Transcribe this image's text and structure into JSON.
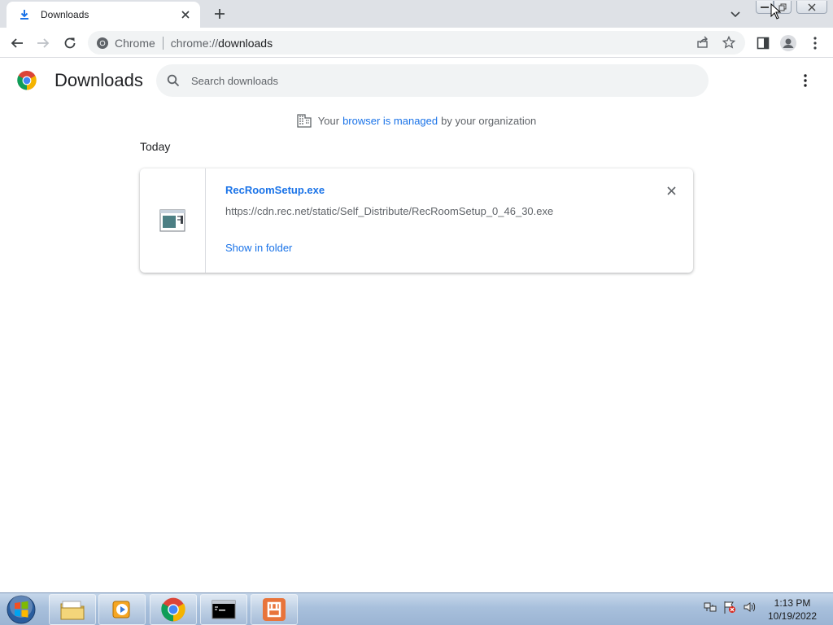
{
  "browser": {
    "tab": {
      "title": "Downloads",
      "favicon": "download-icon"
    },
    "newtab_icon": "plus-icon",
    "omnibox": {
      "site_label": "Chrome",
      "url_prefix": "chrome://",
      "url_host": "downloads"
    }
  },
  "page": {
    "title": "Downloads",
    "search_placeholder": "Search downloads",
    "managed_notice": {
      "prefix": "Your",
      "link": "browser is managed",
      "suffix": "by your organization"
    },
    "section_date": "Today"
  },
  "downloads": [
    {
      "file_name": "RecRoomSetup.exe",
      "url": "https://cdn.rec.net/static/Self_Distribute/RecRoomSetup_0_46_30.exe",
      "action": "Show in folder"
    }
  ],
  "taskbar": {
    "clock_time": "1:13 PM",
    "clock_date": "10/19/2022",
    "items": [
      "file-explorer-icon",
      "media-player-icon",
      "chrome-icon",
      "command-prompt-icon",
      "rec-room-icon"
    ]
  },
  "colors": {
    "accent": "#1a73e8",
    "tabstrip": "#dee1e6",
    "omnibox": "#f1f3f4"
  }
}
